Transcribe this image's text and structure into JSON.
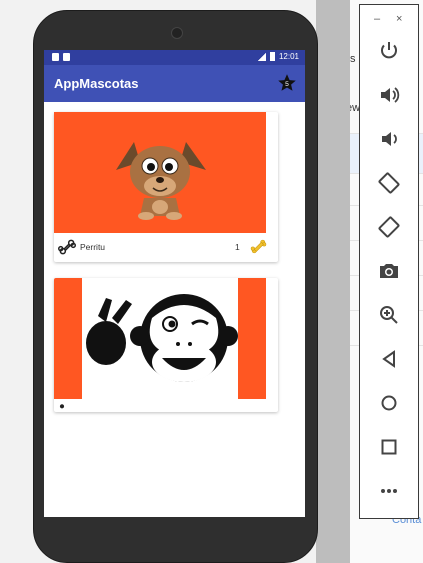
{
  "app": {
    "title": "AppMascotas",
    "status_time": "12:01"
  },
  "pets": [
    {
      "name": "Perritu",
      "likes": "1"
    }
  ],
  "ide": {
    "frag1": "s",
    "frag2": "ew",
    "link": "Conta"
  },
  "emulator": {
    "minimize": "–",
    "close": "×",
    "buttons": [
      "power-icon",
      "volume-up-icon",
      "volume-down-icon",
      "rotate-left-icon",
      "rotate-right-icon",
      "camera-icon",
      "zoom-icon",
      "back-icon",
      "home-icon",
      "overview-icon",
      "more-icon"
    ]
  },
  "colors": {
    "primary": "#3f51b5",
    "primary_dark": "#303f9f",
    "card_background": "#ff5722",
    "dog_brown": "#a97142",
    "bone_gold": "#f2c12e"
  }
}
